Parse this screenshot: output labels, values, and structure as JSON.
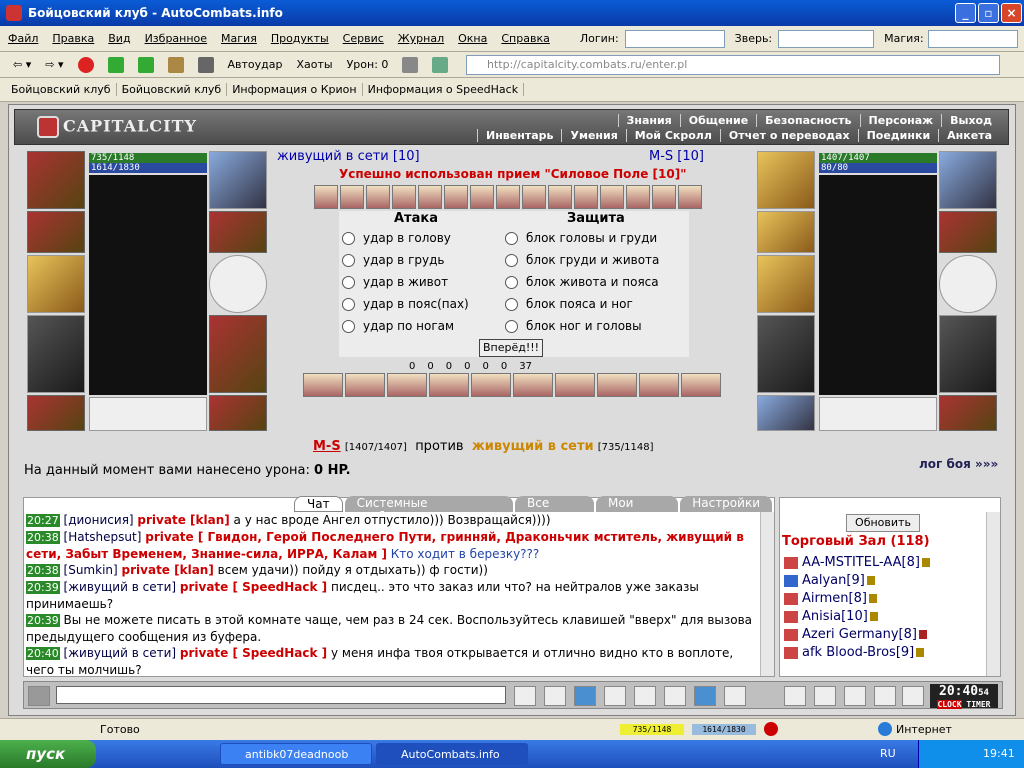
{
  "window": {
    "title": "Бойцовский клуб - AutoCombats.info"
  },
  "menu": {
    "items": [
      "Файл",
      "Правка",
      "Вид",
      "Избранное",
      "Магия",
      "Продукты",
      "Сервис",
      "Журнал",
      "Окна",
      "Справка"
    ],
    "login_label": "Логин:",
    "pet_label": "Зверь:",
    "magic_label": "Магия:"
  },
  "toolbar": {
    "autoudar": "Автоудар",
    "chaoty": "Хаоты",
    "uron": "Урон: 0",
    "address": "http://capitalcity.combats.ru/enter.pl"
  },
  "links": [
    "Бойцовский клуб",
    "Бойцовский клуб",
    "Информация о Крион",
    "Информация о SpeedHack"
  ],
  "game": {
    "logo": "CAPITALCITY",
    "nav_top": [
      "Знания",
      "Общение",
      "Безопасность",
      "Персонаж",
      "Выход"
    ],
    "nav_bottom": [
      "Инвентарь",
      "Умения",
      "Мой Скролл",
      "Отчет о переводах",
      "Поединки",
      "Анкета"
    ],
    "left_char": {
      "hp": "735/1148",
      "mana": "1614/1830",
      "hp_frac": 0.64,
      "mana_frac": 0.88
    },
    "right_char": {
      "hp": "1407/1407",
      "mana": "80/80",
      "hp_frac": 1.0,
      "mana_frac": 1.0
    },
    "fighter_left": "живущий в сети [10]",
    "fighter_right": "M-S [10]",
    "message": "Успешно использован прием \"Силовое Поле [10]\"",
    "attack_title": "Атака",
    "defense_title": "Защита",
    "attacks": [
      "удар в голову",
      "удар в грудь",
      "удар в живот",
      "удар в пояс(пах)",
      "удар по ногам"
    ],
    "defenses": [
      "блок головы и груди",
      "блок груди и живота",
      "блок живота и пояса",
      "блок пояса и ног",
      "блок ног и головы"
    ],
    "go_button": "Вперёд!!!",
    "counters": [
      "0",
      "0",
      "0",
      "0",
      "0",
      "0",
      "37"
    ],
    "vs_left": "M-S",
    "vs_left_hp": "[1407/1407]",
    "vs_word": "против",
    "vs_right": "живущий в сети",
    "vs_right_hp": "[735/1148]",
    "damage_label": "На данный момент вами нанесено урона:",
    "damage_value": "0 HP.",
    "log_link": "лог боя »»»"
  },
  "chat": {
    "tabs": [
      "Чат",
      "Системные сообщения",
      "Все логи",
      "Мои логи",
      "Настройки"
    ],
    "lines": [
      {
        "time": "20:27",
        "who": "[дионисия]",
        "priv": "private [klan]",
        "text": "а у нас вроде Ангел отпустило))) Возвращайся))))"
      },
      {
        "time": "20:38",
        "who": "[Hatshepsut]",
        "priv": "private [ Гвидон, Герой Последнего Пути, гринняй, Драконьчик мститель, живущий в сети, Забыт Временем, Знание-сила, ИРРА, Калам ]",
        "text": "Кто ходит в березку???"
      },
      {
        "time": "20:38",
        "who": "[Sumkin]",
        "priv": "private [klan]",
        "text": "всем удачи)) пойду я отдыхать)) ф гости))"
      },
      {
        "time": "20:39",
        "who": "[живущий в сети]",
        "priv": "private [ SpeedHack ]",
        "text": "писдец.. это что заказ или что? на нейтралов уже заказы принимаешь?"
      },
      {
        "time": "20:39",
        "who": "",
        "priv": "",
        "text": "Вы не можете писать в этой комнате чаще, чем раз в 24 сек. Воспользуйтесь клавишей \"вверх\" для вызова предыдущего сообщения из буфера."
      },
      {
        "time": "20:40",
        "who": "[живущий в сети]",
        "priv": "private [ SpeedHack ]",
        "text": "у меня инфа твоя открывается и отлично видно кто в воплоте, чего ты молчишь?"
      }
    ]
  },
  "side": {
    "refresh": "Обновить",
    "room": "Торговый Зал (118)",
    "users": [
      "AA-MSTITEL-AA[8]",
      "Aalyan[9]",
      "Airmen[8]",
      "Anisia[10]",
      "Azeri Germany[8]",
      "afk Blood-Bros[9]"
    ]
  },
  "clock": {
    "time": "20:40",
    "sec": "54",
    "clock_label": "CLOCK",
    "timer_label": "TIMER"
  },
  "status": {
    "ready": "Готово",
    "hp": "735/1148",
    "mana": "1614/1830",
    "zone": "Интернет"
  },
  "taskbar": {
    "start": "пуск",
    "tasks": [
      "antibk07deadnoob",
      "AutoCombats.info"
    ],
    "lang": "RU",
    "time": "19:41"
  }
}
